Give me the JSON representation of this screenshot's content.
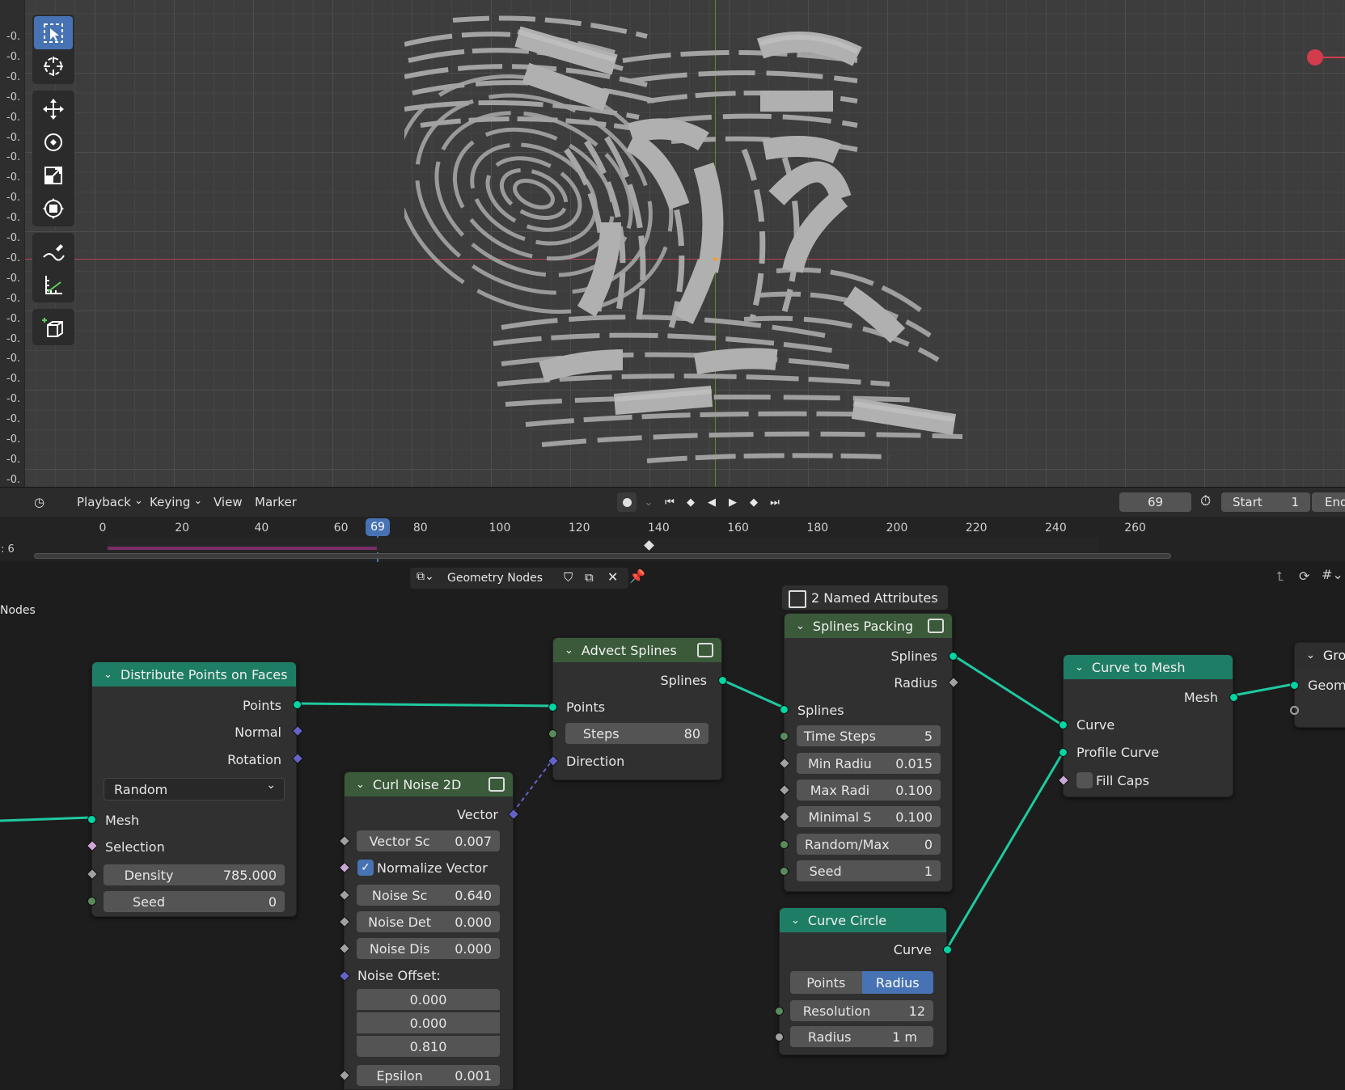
{
  "viewport": {
    "ruler_labels": [
      "-0.",
      "-0.",
      "-0.",
      "-0.",
      "-0.",
      "-0.",
      "-0.",
      "-0.",
      "-0.",
      "-0.",
      "-0.",
      "-0.",
      "-0.",
      "-0.",
      "-0.",
      "-0.",
      "-0.",
      "-0.",
      "-0.",
      "-0.",
      "-0.",
      "-0.",
      "-0.",
      "-0.",
      "-0.",
      "-0."
    ],
    "tools": [
      "select-box-icon",
      "cursor-icon",
      "move-icon",
      "rotate-icon",
      "scale-icon",
      "transform-icon",
      "annotate-icon",
      "measure-icon",
      "add-cube-icon"
    ]
  },
  "timeline": {
    "menus": {
      "playback": "Playback",
      "keying": "Keying",
      "view": "View",
      "marker": "Marker"
    },
    "current_frame": "69",
    "start_label": "Start",
    "start_value": "1",
    "end_label": "End",
    "left_label": ": 6",
    "ruler_numbers": [
      "0",
      "20",
      "40",
      "60",
      "80",
      "100",
      "120",
      "140",
      "160",
      "180",
      "200",
      "220",
      "240",
      "260"
    ],
    "playhead": "69"
  },
  "node_editor": {
    "tree_name": "Geometry Nodes",
    "side_label": "Nodes",
    "named_attributes": "2 Named Attributes",
    "nodes": {
      "distribute": {
        "title": "Distribute Points on Faces",
        "out_points": "Points",
        "out_normal": "Normal",
        "out_rotation": "Rotation",
        "mode": "Random",
        "in_mesh": "Mesh",
        "in_selection": "Selection",
        "density_label": "Density",
        "density_value": "785.000",
        "seed_label": "Seed",
        "seed_value": "0"
      },
      "curl": {
        "title": "Curl Noise 2D",
        "out_vector": "Vector",
        "vector_sc_label": "Vector Sc",
        "vector_sc_value": "0.007",
        "normalize_label": "Normalize Vector",
        "noise_sc_label": "Noise Sc",
        "noise_sc_value": "0.640",
        "noise_det_label": "Noise Det",
        "noise_det_value": "0.000",
        "noise_dis_label": "Noise Dis",
        "noise_dis_value": "0.000",
        "noise_offset_label": "Noise Offset:",
        "offset_x": "0.000",
        "offset_y": "0.000",
        "offset_z": "0.810",
        "epsilon_label": "Epsilon",
        "epsilon_value": "0.001"
      },
      "advect": {
        "title": "Advect Splines",
        "out_splines": "Splines",
        "in_points": "Points",
        "steps_label": "Steps",
        "steps_value": "80",
        "in_direction": "Direction"
      },
      "packing": {
        "title": "Splines Packing",
        "out_splines": "Splines",
        "out_radius": "Radius",
        "in_splines": "Splines",
        "time_steps_label": "Time Steps",
        "time_steps_value": "5",
        "min_radius_label": "Min Radiu",
        "min_radius_value": "0.015",
        "max_radius_label": "Max Radi",
        "max_radius_value": "0.100",
        "minimal_s_label": "Minimal S",
        "minimal_s_value": "0.100",
        "random_max_label": "Random/Max",
        "random_max_value": "0",
        "seed_label": "Seed",
        "seed_value": "1"
      },
      "curve_to_mesh": {
        "title": "Curve to Mesh",
        "out_mesh": "Mesh",
        "in_curve": "Curve",
        "in_profile": "Profile Curve",
        "fill_caps": "Fill Caps"
      },
      "curve_circle": {
        "title": "Curve Circle",
        "out_curve": "Curve",
        "mode_points": "Points",
        "mode_radius": "Radius",
        "resolution_label": "Resolution",
        "resolution_value": "12",
        "radius_label": "Radius",
        "radius_value": "1 m"
      },
      "group_output": {
        "title": "Gro",
        "in_geometry": "Geom"
      }
    }
  },
  "colors": {
    "accent": "#4772b3",
    "node_header": "#1e7d65",
    "geometry_socket": "#00d6a3",
    "vector_socket": "#6363c7"
  }
}
